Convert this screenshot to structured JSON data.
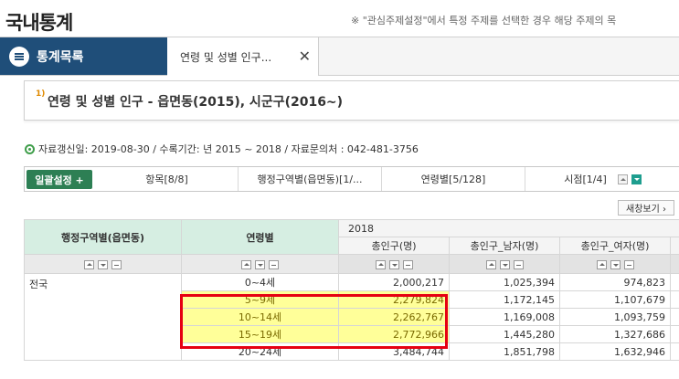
{
  "page": {
    "title": "국내통계",
    "notice": "※ \"관심주제설정\"에서 특정 주제를 선택한 경우 해당 주제의 목"
  },
  "tabs": {
    "stats_label": "통계목록",
    "doc_label": "연령 및 성별 인구...",
    "close": "✕"
  },
  "table_title": {
    "footnote": "1)",
    "text": "연령 및 성별 인구 - 읍면동(2015), 시군구(2016~)"
  },
  "info": {
    "text": "자료갱신일: 2019-08-30 / 수록기간: 년 2015 ~ 2018 / 자료문의처 : 042-481-3756"
  },
  "filters": {
    "batch_label": "일괄설정 +",
    "items": [
      "항목[8/8]",
      "행정구역별(읍면동)[1/...",
      "연령별[5/128]",
      "시점[1/4]"
    ]
  },
  "new_window_label": "새창보기 ›",
  "grid": {
    "header_region": "행정구역별(읍면동)",
    "header_age": "연령별",
    "year": "2018",
    "columns": [
      "총인구(명)",
      "총인구_남자(명)",
      "총인구_여자(명)"
    ],
    "rows": [
      {
        "region": "전국",
        "age": "0~4세",
        "v": [
          "2,000,217",
          "1,025,394",
          "974,823"
        ]
      },
      {
        "region": "",
        "age": "5~9세",
        "v": [
          "2,279,824",
          "1,172,145",
          "1,107,679"
        ]
      },
      {
        "region": "",
        "age": "10~14세",
        "v": [
          "2,262,767",
          "1,169,008",
          "1,093,759"
        ]
      },
      {
        "region": "",
        "age": "15~19세",
        "v": [
          "2,772,966",
          "1,445,280",
          "1,327,686"
        ]
      },
      {
        "region": "",
        "age": "20~24세",
        "v": [
          "3,484,744",
          "1,851,798",
          "1,632,946"
        ]
      }
    ],
    "highlight_rows": [
      1,
      2,
      3
    ]
  },
  "colors": {
    "nav_dark": "#1f4e79",
    "header_green": "#d6eee2",
    "highlight_yellow": "#ffff99",
    "annotation_red": "#e60012",
    "button_green": "#2d7f54"
  }
}
